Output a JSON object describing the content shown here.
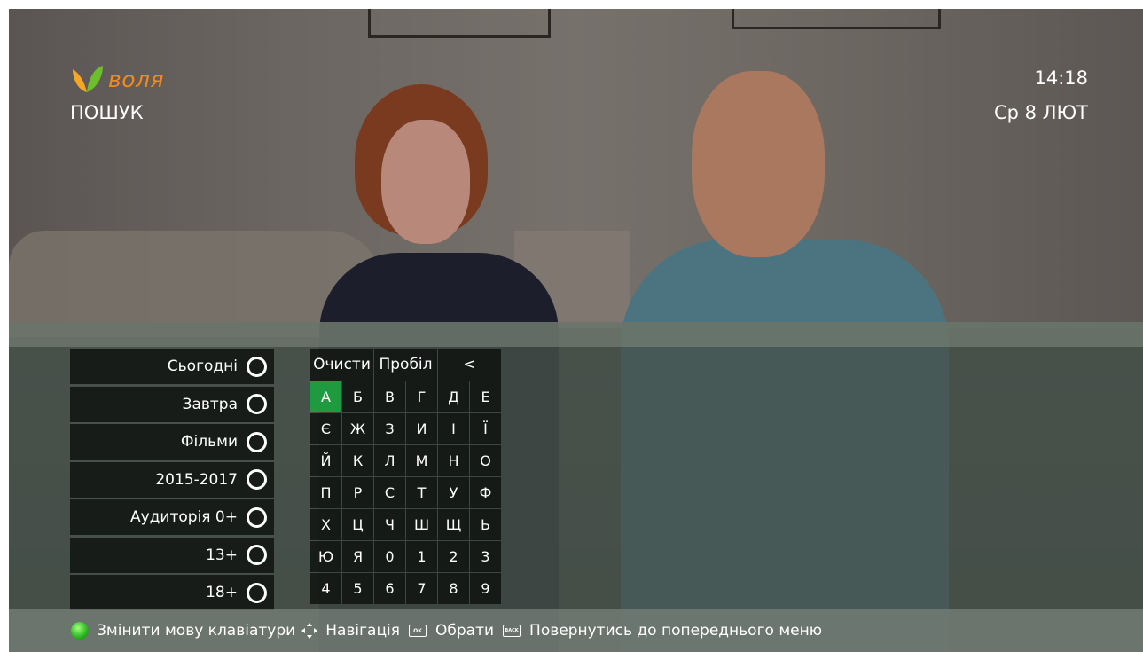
{
  "header": {
    "logo_text": "воля",
    "page_title": "ПОШУК",
    "time": "14:18",
    "date": "Ср 8 ЛЮТ"
  },
  "filters": [
    {
      "label": "Сьогодні"
    },
    {
      "label": "Завтра"
    },
    {
      "label": "Фільми"
    },
    {
      "label": "2015-2017"
    },
    {
      "label": "Аудиторія 0+"
    },
    {
      "label": "13+"
    },
    {
      "label": "18+"
    }
  ],
  "keyboard": {
    "clear_label": "Очисти",
    "space_label": "Пробіл",
    "backspace_label": "<",
    "selected_key": "А",
    "keys": [
      "А",
      "Б",
      "В",
      "Г",
      "Д",
      "Е",
      "Є",
      "Ж",
      "З",
      "И",
      "І",
      "Ї",
      "Й",
      "К",
      "Л",
      "М",
      "Н",
      "О",
      "П",
      "Р",
      "С",
      "Т",
      "У",
      "Ф",
      "Х",
      "Ц",
      "Ч",
      "Ш",
      "Щ",
      "Ь",
      "Ю",
      "Я",
      "0",
      "1",
      "2",
      "3",
      "4",
      "5",
      "6",
      "7",
      "8",
      "9"
    ]
  },
  "footer": {
    "change_language": "Змінити мову клавіатури",
    "navigation": "Навігація",
    "ok_icon": "OK",
    "select": "Обрати",
    "back_icon": "BACK",
    "back": "Повернутись до попереднього меню"
  },
  "colors": {
    "accent_orange": "#f28a1c",
    "selected_green": "#1f9a3e",
    "panel_dark": "#0a0e0c"
  }
}
